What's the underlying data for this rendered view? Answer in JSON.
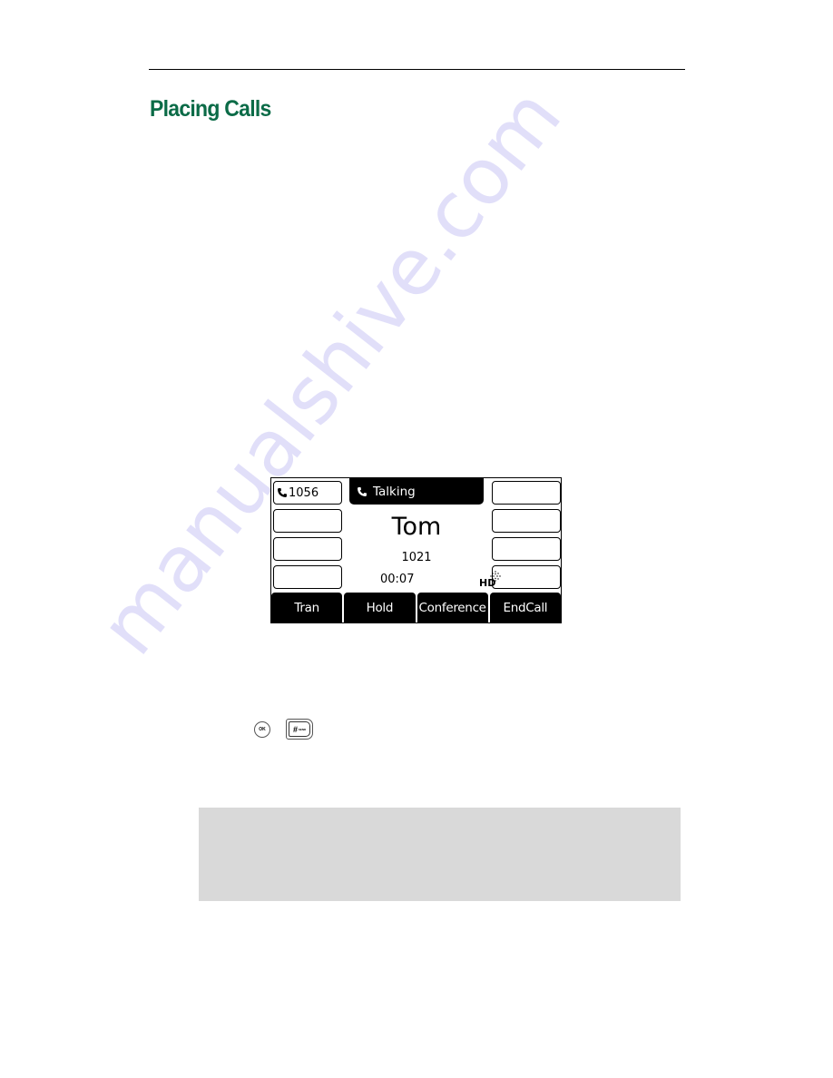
{
  "page": {
    "title": "Placing Calls",
    "title_color": "#0b6b47",
    "watermark": "manualshive.com"
  },
  "phone_screen": {
    "status": {
      "icon": "handset-icon",
      "label": "Talking"
    },
    "line_keys_left": [
      {
        "icon": "handset-icon",
        "label": "1056"
      },
      {
        "label": ""
      },
      {
        "label": ""
      },
      {
        "label": ""
      }
    ],
    "line_keys_right": [
      {
        "label": ""
      },
      {
        "label": ""
      },
      {
        "label": ""
      },
      {
        "label": ""
      }
    ],
    "caller_name": "Tom",
    "caller_number": "1021",
    "duration": "00:07",
    "hd_label": "HD",
    "softkeys": [
      "Tran",
      "Hold",
      "Conference",
      "EndCall"
    ]
  },
  "keys": {
    "ok_label": "OK",
    "hash_label": "#",
    "hash_sublabel": "SEND"
  },
  "note_box": {
    "text": ""
  }
}
